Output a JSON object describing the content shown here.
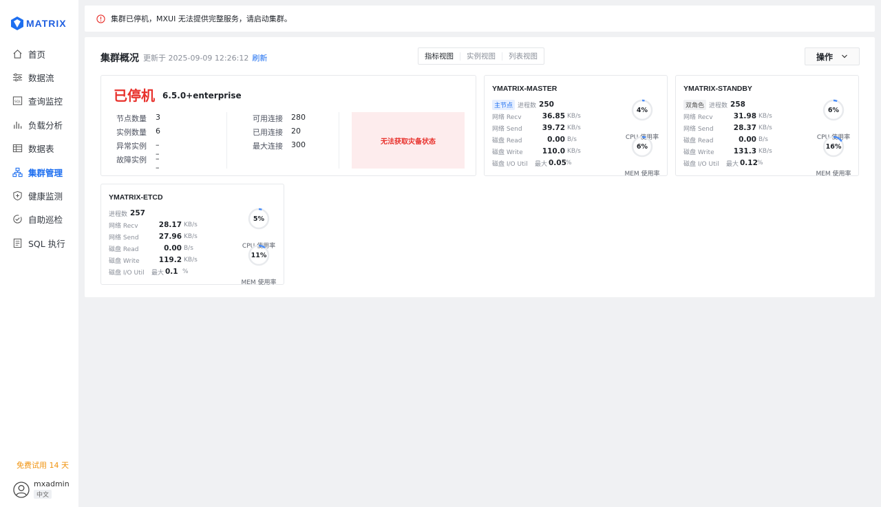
{
  "brand": {
    "name": "MATRIX",
    "color": "#1e6ff0"
  },
  "sidebar": {
    "items": [
      {
        "label": "首页",
        "icon": "home-icon"
      },
      {
        "label": "数据流",
        "icon": "dataflow-icon"
      },
      {
        "label": "查询监控",
        "icon": "sql-monitor-icon"
      },
      {
        "label": "负载分析",
        "icon": "bar-chart-icon"
      },
      {
        "label": "数据表",
        "icon": "table-icon"
      },
      {
        "label": "集群管理",
        "icon": "cluster-icon",
        "active": true
      },
      {
        "label": "健康监测",
        "icon": "shield-icon"
      },
      {
        "label": "自助巡检",
        "icon": "inspection-icon"
      },
      {
        "label": "SQL 执行",
        "icon": "sql-exec-icon"
      }
    ],
    "trial": "免费试用 14 天",
    "user": {
      "name": "mxadmin",
      "lang": "中文"
    }
  },
  "alert": {
    "text": "集群已停机，MXUI 无法提供完整服务，请启动集群。",
    "color": "#e8312c"
  },
  "header": {
    "title": "集群概况",
    "updated_label": "更新于 2025-09-09 12:26:12",
    "refresh": "刷新",
    "views": [
      "指标视图",
      "实例视图",
      "列表视图"
    ],
    "ops": "操作"
  },
  "summary": {
    "status": "已停机",
    "version": "6.5.0+enterprise",
    "left": [
      {
        "k": "节点数量",
        "v": "3"
      },
      {
        "k": "实例数量",
        "v": "6"
      },
      {
        "k": "异常实例",
        "v": "– –"
      },
      {
        "k": "故障实例",
        "v": "– –"
      }
    ],
    "right": [
      {
        "k": "可用连接",
        "v": "280"
      },
      {
        "k": "已用连接",
        "v": "20"
      },
      {
        "k": "最大连接",
        "v": "300"
      }
    ],
    "dr_status": "无法获取灾备状态"
  },
  "nodes": [
    {
      "name": "YMATRIX-MASTER",
      "role": "主节点",
      "proc_label": "进程数",
      "proc": "250",
      "recv_label": "网络 Recv",
      "recv": "36.85",
      "recv_unit": "KB/s",
      "send_label": "网络 Send",
      "send": "39.72",
      "send_unit": "KB/s",
      "read_label": "磁盘 Read",
      "read": "0.00",
      "read_unit": "B/s",
      "write_label": "磁盘 Write",
      "write": "110.0",
      "write_unit": "KB/s",
      "io_label": "磁盘 I/O Util",
      "io_max": "最大",
      "io": "0.05",
      "io_unit": "%",
      "cpu": 4,
      "cpu_text": "4%",
      "cpu_label": "CPU 使用率",
      "mem": 6,
      "mem_text": "6%",
      "mem_label": "MEM 使用率"
    },
    {
      "name": "YMATRIX-STANDBY",
      "role": "双角色",
      "proc_label": "进程数",
      "proc": "258",
      "recv_label": "网络 Recv",
      "recv": "31.98",
      "recv_unit": "KB/s",
      "send_label": "网络 Send",
      "send": "28.37",
      "send_unit": "KB/s",
      "read_label": "磁盘 Read",
      "read": "0.00",
      "read_unit": "B/s",
      "write_label": "磁盘 Write",
      "write": "131.3",
      "write_unit": "KB/s",
      "io_label": "磁盘 I/O Util",
      "io_max": "最大",
      "io": "0.12",
      "io_unit": "%",
      "cpu": 6,
      "cpu_text": "6%",
      "cpu_label": "CPU 使用率",
      "mem": 16,
      "mem_text": "16%",
      "mem_label": "MEM 使用率"
    },
    {
      "name": "YMATRIX-ETCD",
      "role": "",
      "proc_label": "进程数",
      "proc": "257",
      "recv_label": "网络 Recv",
      "recv": "28.17",
      "recv_unit": "KB/s",
      "send_label": "网络 Send",
      "send": "27.96",
      "send_unit": "KB/s",
      "read_label": "磁盘 Read",
      "read": "0.00",
      "read_unit": "B/s",
      "write_label": "磁盘 Write",
      "write": "119.2",
      "write_unit": "KB/s",
      "io_label": "磁盘 I/O Util",
      "io_max": "最大",
      "io": "0.1",
      "io_unit": "%",
      "cpu": 5,
      "cpu_text": "5%",
      "cpu_label": "CPU 使用率",
      "mem": 11,
      "mem_text": "11%",
      "mem_label": "MEM 使用率"
    }
  ]
}
